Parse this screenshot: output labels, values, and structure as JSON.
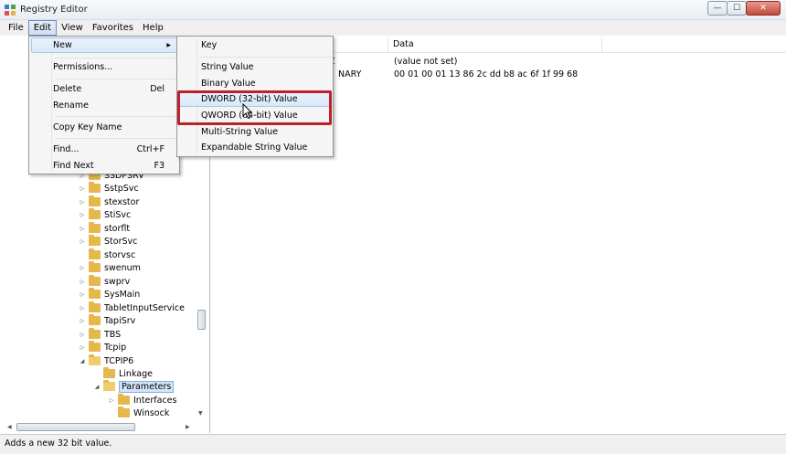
{
  "window": {
    "title": "Registry Editor",
    "minimize_glyph": "—",
    "maximize_glyph": "☐",
    "close_glyph": "✕"
  },
  "menubar": [
    "File",
    "Edit",
    "View",
    "Favorites",
    "Help"
  ],
  "edit_menu": {
    "new": "New",
    "permissions": "Permissions...",
    "delete": "Delete",
    "delete_shortcut": "Del",
    "rename": "Rename",
    "copy_key_name": "Copy Key Name",
    "find": "Find...",
    "find_shortcut": "Ctrl+F",
    "find_next": "Find Next",
    "find_next_shortcut": "F3"
  },
  "new_submenu": {
    "key": "Key",
    "string_value": "String Value",
    "binary_value": "Binary Value",
    "dword_value": "DWORD (32-bit) Value",
    "qword_value": "QWORD (64-bit) Value",
    "multi_string_value": "Multi-String Value",
    "expandable_string_value": "Expandable String Value"
  },
  "tree": {
    "partial_top": "SSDPSRV",
    "items": [
      "SstpSvc",
      "stexstor",
      "StiSvc",
      "storflt",
      "StorSvc",
      "storvsc",
      "swenum",
      "swprv",
      "SysMain",
      "TabletInputService",
      "TapiSrv",
      "TBS",
      "Tcpip",
      "TCPIP6"
    ],
    "tcpip6_children": [
      "Linkage",
      "Parameters"
    ],
    "parameters_children": [
      "Interfaces",
      "Winsock"
    ],
    "selected": "Parameters"
  },
  "values_list": {
    "headers": {
      "data": "Data"
    },
    "rows": [
      {
        "type": "Z",
        "data": "(value not set)"
      },
      {
        "type": "NARY",
        "data": "00 01 00 01 13 86 2c dd b8 ac 6f 1f 99 68"
      }
    ]
  },
  "status_text": "Adds a new 32 bit value.",
  "accent_color": "#c0202a"
}
